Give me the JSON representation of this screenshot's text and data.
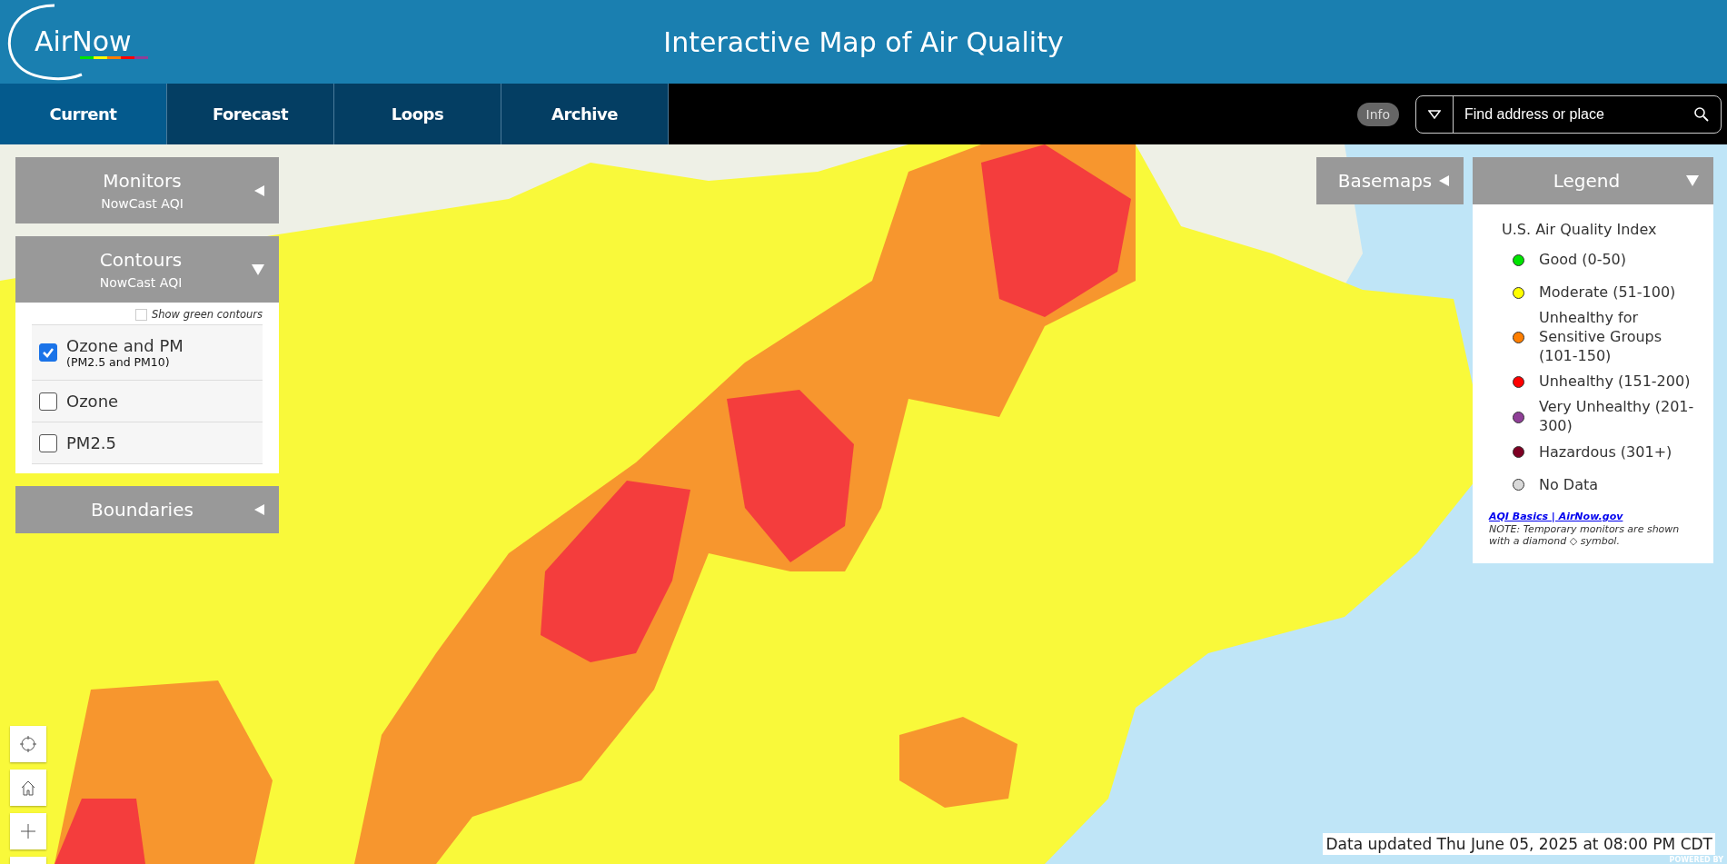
{
  "header": {
    "logo": "AirNow",
    "title": "Interactive Map of Air Quality"
  },
  "tabs": [
    {
      "label": "Current",
      "selected": true
    },
    {
      "label": "Forecast",
      "selected": false
    },
    {
      "label": "Loops",
      "selected": false
    },
    {
      "label": "Archive",
      "selected": false
    }
  ],
  "info_button": "Info",
  "search": {
    "placeholder": "Find address or place"
  },
  "left_panels": [
    {
      "title": "Monitors",
      "subtitle": "NowCast AQI",
      "expanded": false
    },
    {
      "title": "Contours",
      "subtitle": "NowCast AQI",
      "expanded": true
    },
    {
      "title": "Boundaries",
      "expanded": false
    }
  ],
  "contours": {
    "show_green": {
      "label": "Show green contours",
      "checked": false
    },
    "options": [
      {
        "label": "Ozone and PM",
        "sublabel": "(PM2.5 and PM10)",
        "checked": true
      },
      {
        "label": "Ozone",
        "checked": false
      },
      {
        "label": "PM2.5",
        "checked": false
      }
    ]
  },
  "basemaps": {
    "title": "Basemaps",
    "expanded": false
  },
  "legend": {
    "title": "Legend",
    "expanded": true,
    "heading": "U.S. Air Quality Index",
    "items": [
      {
        "label": "Good (0-50)",
        "color": "#00e400"
      },
      {
        "label": "Moderate (51-100)",
        "color": "#ffff00"
      },
      {
        "label": "Unhealthy for Sensitive Groups (101-150)",
        "color": "#ff7e00"
      },
      {
        "label": "Unhealthy (151-200)",
        "color": "#ff0000"
      },
      {
        "label": "Very Unhealthy (201-300)",
        "color": "#8f3f97"
      },
      {
        "label": "Hazardous (301+)",
        "color": "#7e0023"
      },
      {
        "label": "No Data",
        "color": "#d9d9d9"
      }
    ],
    "link": "AQI Basics | AirNow.gov",
    "note": "NOTE: Temporary monitors are shown with a diamond ◇ symbol."
  },
  "status": "Data updated Thu June 05, 2025 at 08:00 PM CDT",
  "attribution": "POWERED BY"
}
